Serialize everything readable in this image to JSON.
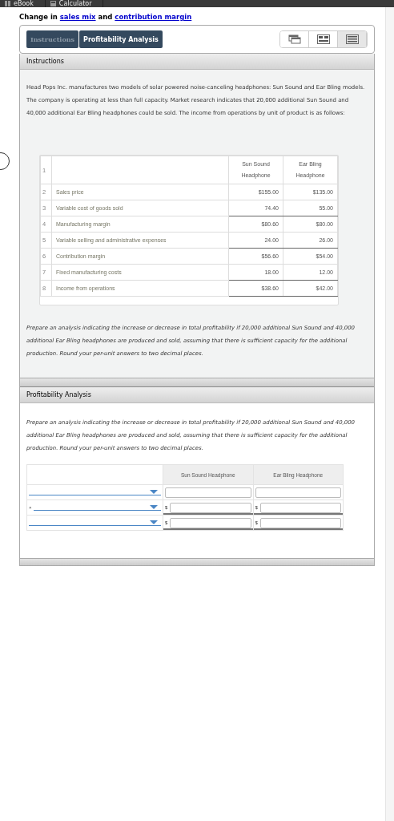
{
  "top_bar": {
    "tabs": [
      {
        "label": "eBook",
        "kind": "book"
      },
      {
        "label": "Calculator",
        "kind": "calc"
      }
    ]
  },
  "title": {
    "text": "Change in ",
    "links": [
      "sales mix",
      "contribution margin"
    ],
    "joiner": " and "
  },
  "tabs": [
    {
      "label": "Instructions",
      "selected": false
    },
    {
      "label": "Profitability Analysis",
      "selected": true
    }
  ],
  "view_buttons": [
    {
      "kind": "windows",
      "selected": false
    },
    {
      "kind": "split",
      "selected": false
    },
    {
      "kind": "lines",
      "selected": true
    }
  ],
  "instructions": {
    "header": "Instructions",
    "intro": "Head Pops Inc. manufactures two models of solar powered noise-canceling headphones: Sun Sound and Ear Bling models. The company is operating at less than full capacity. Market research indicates that 20,000 additional Sun Sound and 40,000 additional Ear Bling headphones could be sold. The income from operations by unit of product is as follows:",
    "table": {
      "header_number": "1",
      "columns": [
        "Sun Sound Headphone",
        "Ear Bling Headphone"
      ],
      "rows": [
        {
          "number": "2",
          "label": "Sales price",
          "values": [
            "$155.00",
            "$135.00"
          ],
          "underline": false
        },
        {
          "number": "3",
          "label": "Variable cost of goods sold",
          "values": [
            "74.40",
            "55.00"
          ],
          "underline": true
        },
        {
          "number": "4",
          "label": "Manufacturing margin",
          "values": [
            "$80.60",
            "$80.00"
          ],
          "underline": false
        },
        {
          "number": "5",
          "label": "Variable selling and administrative expenses",
          "values": [
            "24.00",
            "26.00"
          ],
          "underline": true
        },
        {
          "number": "6",
          "label": "Contribution margin",
          "values": [
            "$56.60",
            "$54.00"
          ],
          "underline": false
        },
        {
          "number": "7",
          "label": "Fixed manufacturing costs",
          "values": [
            "18.00",
            "12.00"
          ],
          "underline": true
        },
        {
          "number": "8",
          "label": "Income from operations",
          "values": [
            "$38.60",
            "$42.00"
          ],
          "underline": true
        }
      ]
    },
    "task": "Prepare an analysis indicating the increase or decrease in total profitability if 20,000 additional Sun Sound and 40,000 additional Ear Bling headphones are produced and sold, assuming that there is sufficient capacity for the additional production. Round your per-unit answers to two decimal places."
  },
  "analysis": {
    "header": "Profitability Analysis",
    "task": "Prepare an analysis indicating the increase or decrease in total profitability if 20,000 additional Sun Sound and 40,000 additional Ear Bling headphones are produced and sold, assuming that there is sufficient capacity for the additional production. Round your per-unit answers to two decimal places.",
    "columns": [
      "Sun Sound Headphone",
      "Ear Bling Headphone"
    ],
    "rows": [
      {
        "marker": "",
        "currency": "",
        "underline": false
      },
      {
        "marker": "×",
        "currency": "$",
        "underline": true
      },
      {
        "marker": "",
        "currency": "$",
        "underline": true
      }
    ]
  }
}
